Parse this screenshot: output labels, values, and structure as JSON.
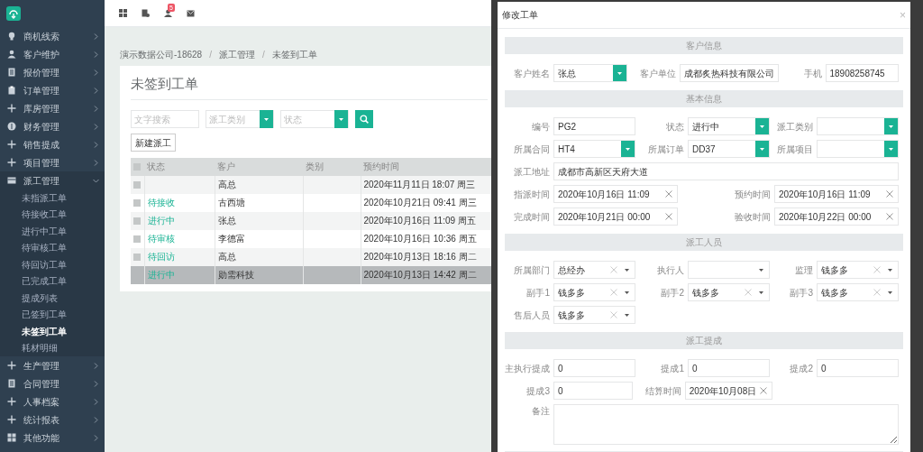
{
  "sidebar": {
    "items": [
      {
        "label": "商机线索",
        "expanded": false
      },
      {
        "label": "客户维护",
        "expanded": false
      },
      {
        "label": "报价管理",
        "expanded": false
      },
      {
        "label": "订单管理",
        "expanded": false
      },
      {
        "label": "库房管理",
        "expanded": false
      },
      {
        "label": "财务管理",
        "expanded": false
      },
      {
        "label": "销售提成",
        "expanded": false
      },
      {
        "label": "项目管理",
        "expanded": false
      },
      {
        "label": "派工管理",
        "expanded": true,
        "children": [
          {
            "label": "未指派工单",
            "selected": false
          },
          {
            "label": "待接收工单",
            "selected": false
          },
          {
            "label": "进行中工单",
            "selected": false
          },
          {
            "label": "待审核工单",
            "selected": false
          },
          {
            "label": "待回访工单",
            "selected": false
          },
          {
            "label": "已完成工单",
            "selected": false
          },
          {
            "label": "提成列表",
            "selected": false
          },
          {
            "label": "已签到工单",
            "selected": false
          },
          {
            "label": "未签到工单",
            "selected": true
          },
          {
            "label": "耗材明细",
            "selected": false
          }
        ]
      },
      {
        "label": "生产管理",
        "expanded": false
      },
      {
        "label": "合同管理",
        "expanded": false
      },
      {
        "label": "人事档案",
        "expanded": false
      },
      {
        "label": "统计报表",
        "expanded": false
      },
      {
        "label": "其他功能",
        "expanded": false
      }
    ]
  },
  "topbar": {
    "badge": "5"
  },
  "breadcrumb": [
    {
      "kind": "link",
      "text": "演示数据公司-18628"
    },
    {
      "kind": "separator",
      "text": "/"
    },
    {
      "kind": "link",
      "text": "派工管理"
    },
    {
      "kind": "separator",
      "text": "/"
    },
    {
      "kind": "link",
      "text": "未签到工单"
    }
  ],
  "page_title": "未签到工单",
  "filters": {
    "search_placeholder": "文字搜索",
    "type_placeholder": "派工类别",
    "status_placeholder": "状态"
  },
  "new_button": "新建派工",
  "table": {
    "all_checked": false,
    "columns": [
      "状态",
      "客户",
      "类别",
      "预约时间"
    ],
    "rows": [
      {
        "customer": "高总",
        "time": "2020年11月11日 18:07 周三",
        "selected": false
      },
      {
        "status": "待接收",
        "customer": "古西塘",
        "time": "2020年10月21日 09:41 周三",
        "selected": false
      },
      {
        "status": "进行中",
        "customer": "张总",
        "time": "2020年10月16日 11:09 周五",
        "selected": false
      },
      {
        "status": "待审核",
        "customer": "李德富",
        "time": "2020年10月16日 10:36 周五",
        "selected": false
      },
      {
        "status": "待回访",
        "customer": "高总",
        "time": "2020年10月13日 18:16 周二",
        "selected": false
      },
      {
        "status": "进行中",
        "customer": "勋需科技",
        "time": "2020年10月13日 14:42 周二",
        "selected": true
      }
    ]
  },
  "modal": {
    "title": "修改工单",
    "close": "×",
    "sections": [
      {
        "title": "客户信息",
        "rows": [
          {
            "kind": "three",
            "fields": [
              {
                "label": "客户姓名",
                "kind": "select",
                "value": "张总"
              },
              {
                "label": "客户单位",
                "kind": "text",
                "value": "成都炙热科技有限公司"
              },
              {
                "label": "手机",
                "kind": "text",
                "value": "18908258745"
              }
            ]
          }
        ]
      },
      {
        "title": "基本信息",
        "rows": [
          {
            "kind": "three",
            "fields": [
              {
                "label": "编号",
                "kind": "text",
                "value": "PG2"
              },
              {
                "label": "状态",
                "kind": "select",
                "value": "进行中"
              },
              {
                "label": "派工类别",
                "kind": "select"
              }
            ]
          },
          {
            "kind": "three",
            "fields": [
              {
                "label": "所属合同",
                "kind": "select",
                "value": "HT4"
              },
              {
                "label": "所属订单",
                "kind": "select",
                "value": "DD37"
              },
              {
                "label": "所属项目",
                "kind": "select"
              }
            ]
          },
          {
            "kind": "full",
            "fields": [
              {
                "label": "派工地址",
                "kind": "text",
                "value": "成都市高新区天府大道"
              }
            ]
          },
          {
            "kind": "two",
            "fields": [
              {
                "label": "指派时间",
                "kind": "date",
                "value": "2020年10月16日 11:09"
              },
              {
                "label": "预约时间",
                "kind": "date",
                "value": "2020年10月16日 11:09"
              }
            ]
          },
          {
            "kind": "two",
            "fields": [
              {
                "label": "完成时间",
                "kind": "date",
                "value": "2020年10月21日 00:00"
              },
              {
                "label": "验收时间",
                "kind": "date",
                "value": "2020年10月22日 00:00"
              }
            ]
          }
        ]
      },
      {
        "title": "派工人员",
        "rows": [
          {
            "kind": "three",
            "fields": [
              {
                "label": "所属部门",
                "kind": "select2",
                "value": "总经办"
              },
              {
                "label": "执行人",
                "kind": "dropdown"
              },
              {
                "label": "监理",
                "kind": "select2",
                "value": "钱多多"
              }
            ]
          },
          {
            "kind": "three",
            "fields": [
              {
                "label": "副手1",
                "kind": "select2",
                "value": "钱多多"
              },
              {
                "label": "副手2",
                "kind": "select2",
                "value": "钱多多"
              },
              {
                "label": "副手3",
                "kind": "select2",
                "value": "钱多多"
              }
            ]
          },
          {
            "kind": "three",
            "fields": [
              {
                "label": "售后人员",
                "kind": "select2",
                "value": "钱多多"
              }
            ]
          }
        ]
      },
      {
        "title": "派工提成",
        "rows": [
          {
            "kind": "three",
            "fields": [
              {
                "label": "主执行提成",
                "kind": "text",
                "value": "0"
              },
              {
                "label": "提成1",
                "kind": "text",
                "value": "0"
              },
              {
                "label": "提成2",
                "kind": "text",
                "value": "0"
              }
            ]
          },
          {
            "kind": "three",
            "fields": [
              {
                "label": "提成3",
                "kind": "text",
                "value": "0"
              },
              {
                "label": "结算时间",
                "kind": "date",
                "value": "2020年10月08日"
              }
            ]
          },
          {
            "kind": "full",
            "fields": [
              {
                "label": "备注",
                "kind": "textarea"
              }
            ]
          }
        ]
      }
    ]
  }
}
